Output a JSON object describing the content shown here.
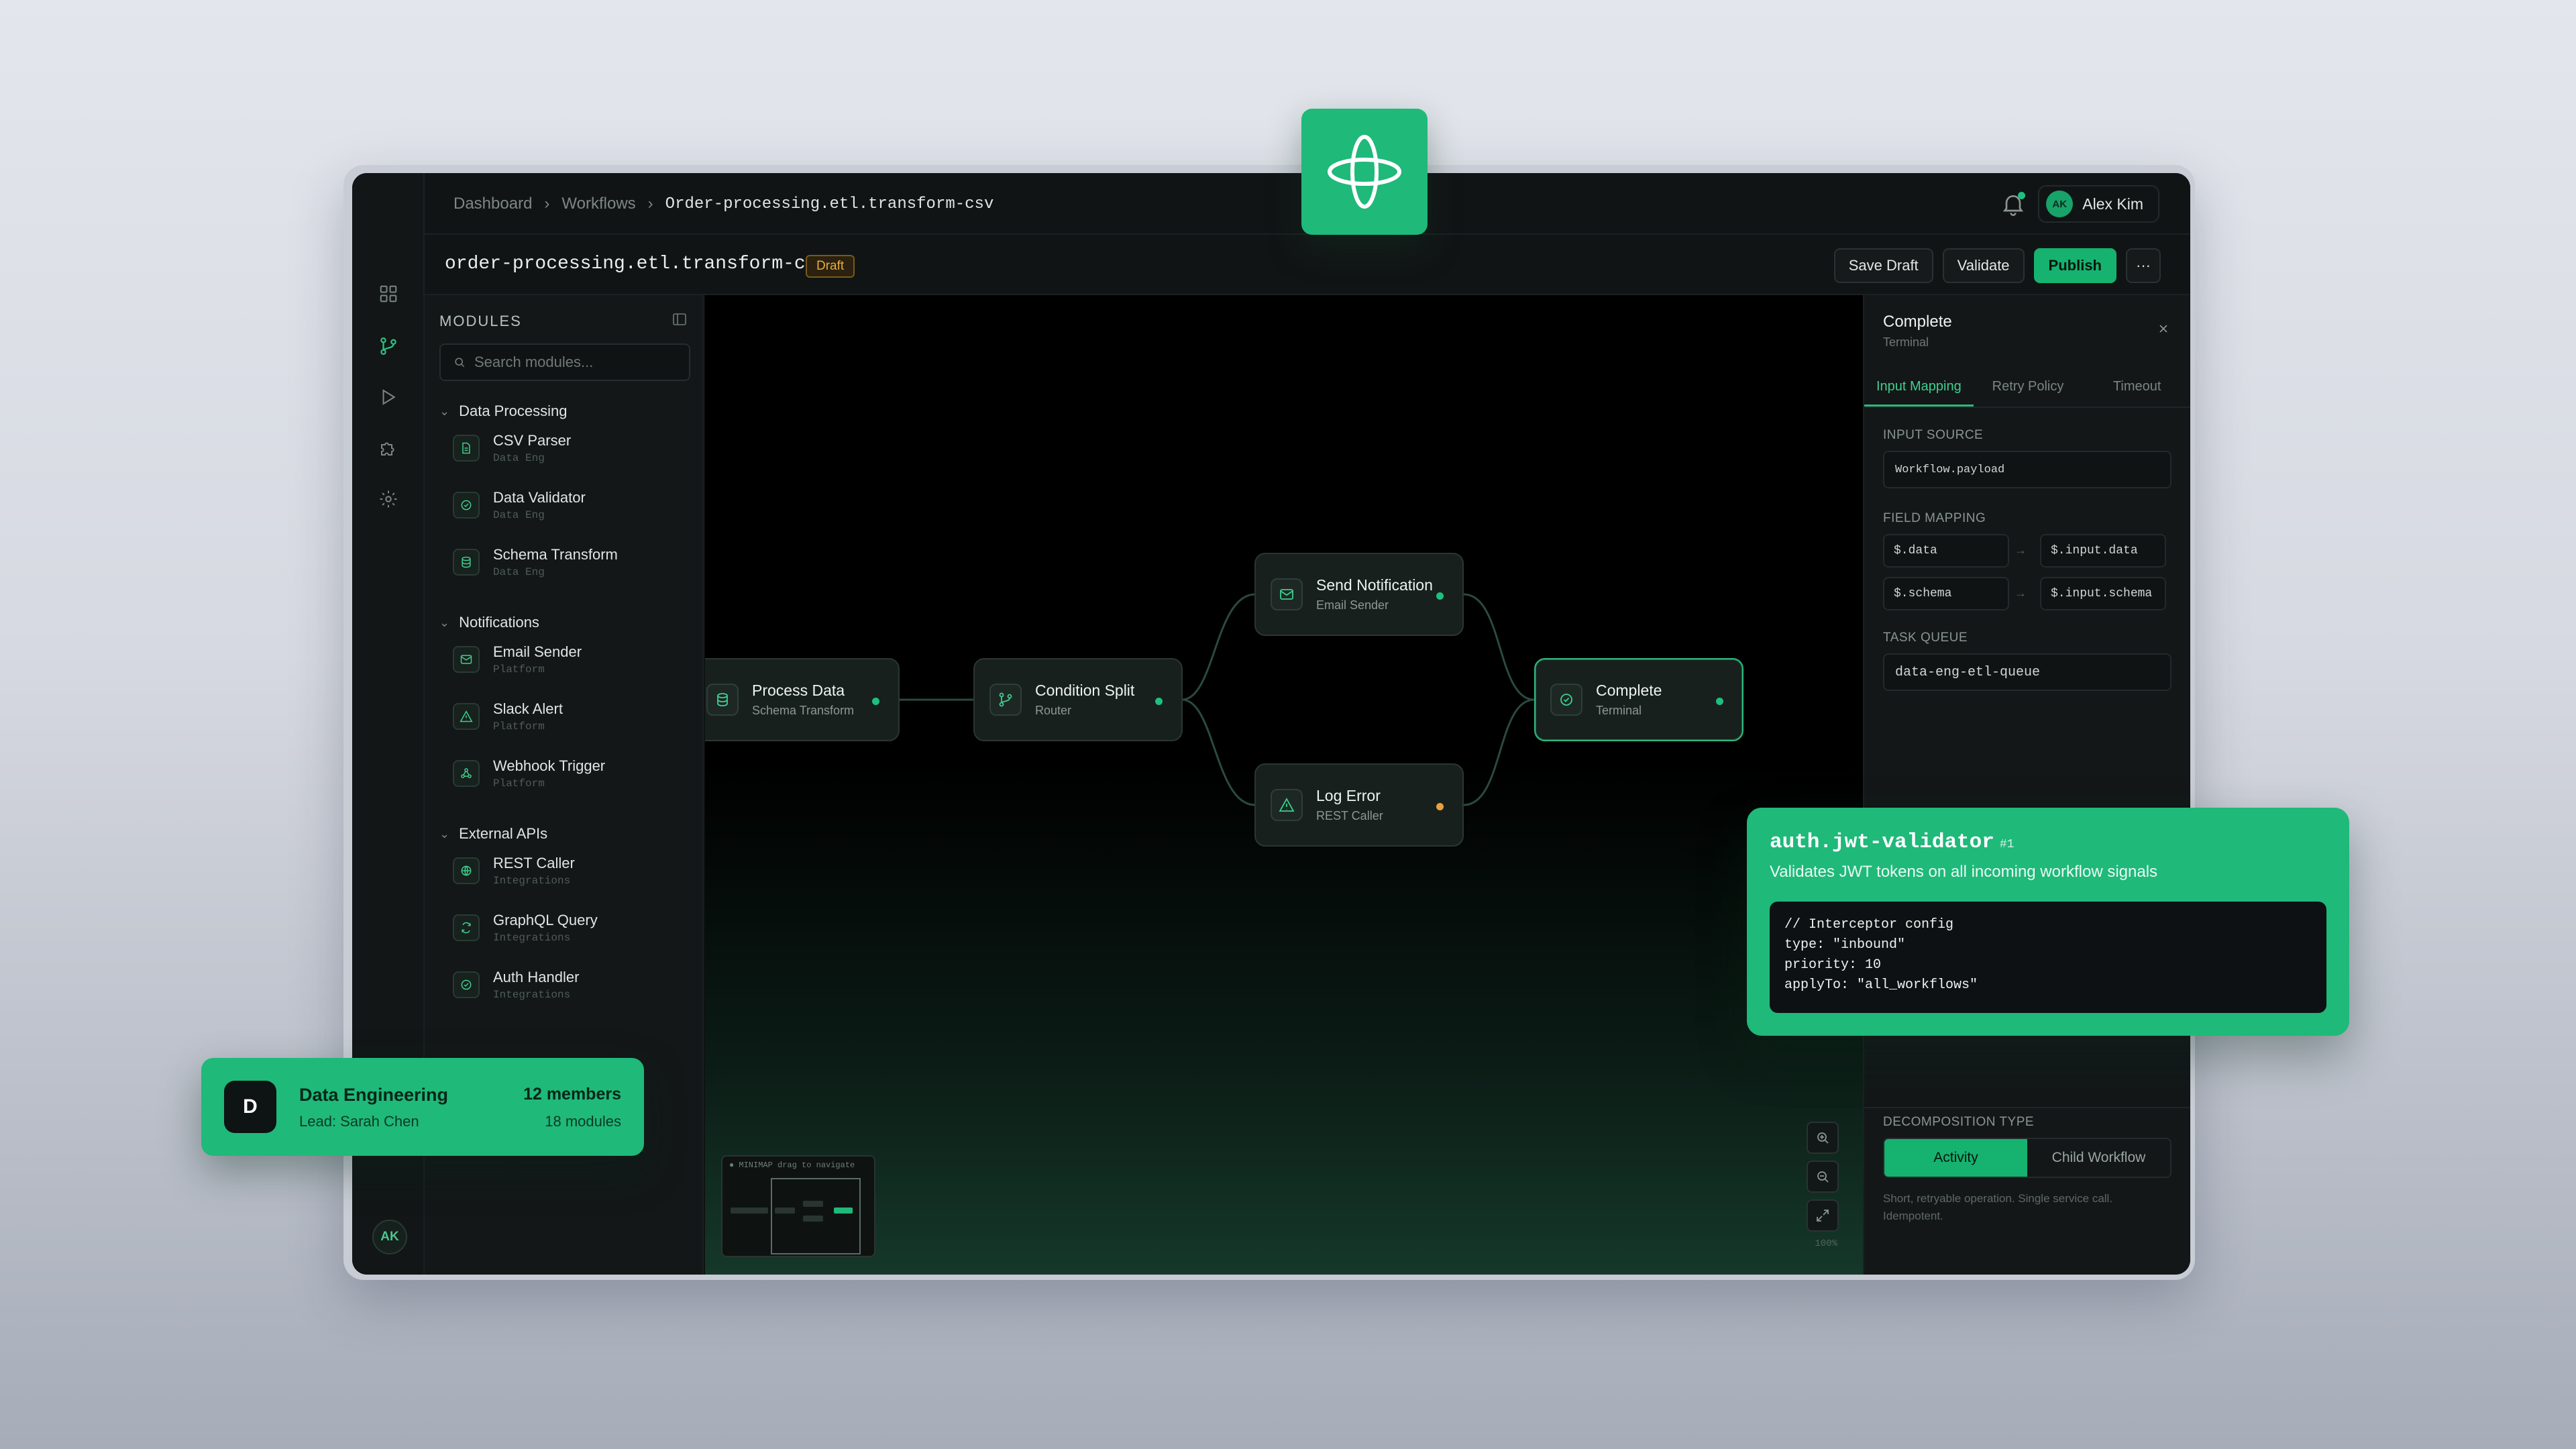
{
  "colors": {
    "accent": "#1fb97a",
    "draft": "#e9ad3a",
    "warn_port": "#e9a23b"
  },
  "breadcrumb": [
    "Dashboard",
    "Workflows",
    "Order-processing.etl.transform-csv"
  ],
  "user": {
    "initials": "AK",
    "name": "Alex Kim"
  },
  "workflow": {
    "name": "order-processing.etl.transform-csv",
    "status": "Draft"
  },
  "actions": {
    "save": "Save Draft",
    "validate": "Validate",
    "publish": "Publish",
    "more": "···"
  },
  "rail": {
    "icons": [
      "grid-icon",
      "branch-icon",
      "play-icon",
      "puzzle-icon",
      "gear-icon"
    ],
    "avatar": "AK"
  },
  "modules": {
    "title": "MODULES",
    "search_placeholder": "Search modules...",
    "groups": [
      {
        "name": "Data Processing",
        "items": [
          {
            "title": "CSV Parser",
            "sub": "Data Eng"
          },
          {
            "title": "Data Validator",
            "sub": "Data Eng"
          },
          {
            "title": "Schema Transform",
            "sub": "Data Eng"
          }
        ]
      },
      {
        "name": "Notifications",
        "items": [
          {
            "title": "Email Sender",
            "sub": "Platform"
          },
          {
            "title": "Slack Alert",
            "sub": "Platform"
          },
          {
            "title": "Webhook Trigger",
            "sub": "Platform"
          }
        ]
      },
      {
        "name": "External APIs",
        "items": [
          {
            "title": "REST Caller",
            "sub": "Integrations"
          },
          {
            "title": "GraphQL Query",
            "sub": "Integrations"
          },
          {
            "title": "Auth Handler",
            "sub": "Integrations"
          }
        ]
      }
    ]
  },
  "nodes": [
    {
      "title": "Process Data",
      "sub": "Schema Transform"
    },
    {
      "title": "Condition Split",
      "sub": "Router"
    },
    {
      "title": "Send Notification",
      "sub": "Email Sender"
    },
    {
      "title": "Log Error",
      "sub": "REST Caller"
    },
    {
      "title": "Complete",
      "sub": "Terminal"
    }
  ],
  "minimap": {
    "label": "● MINIMAP  drag to navigate"
  },
  "zoom": "100%",
  "inspector": {
    "title": "Complete",
    "subtitle": "Terminal",
    "tabs": [
      "Input Mapping",
      "Retry Policy",
      "Timeout"
    ],
    "input_source_label": "INPUT SOURCE",
    "input_source": "Workflow.payload",
    "field_mapping_label": "FIELD MAPPING",
    "mappings": [
      {
        "from": "$.data",
        "to": "$.input.data"
      },
      {
        "from": "$.schema",
        "to": "$.input.schema"
      }
    ],
    "task_queue_label": "TASK QUEUE",
    "task_queue": "data-eng-etl-queue",
    "decomp_label": "DECOMPOSITION TYPE",
    "decomp_options": [
      "Activity",
      "Child Workflow"
    ],
    "decomp_note": "Short, retryable operation. Single service call. Idempotent."
  },
  "team": {
    "initial": "D",
    "name": "Data Engineering",
    "lead": "Lead: Sarah Chen",
    "members": "12 members",
    "modules": "18 modules"
  },
  "interceptor": {
    "name": "auth.jwt-validator",
    "index": "#1",
    "description": "Validates JWT tokens on all incoming workflow signals",
    "code": "// Interceptor config\ntype: \"inbound\"\npriority: 10\napplyTo: \"all_workflows\""
  }
}
